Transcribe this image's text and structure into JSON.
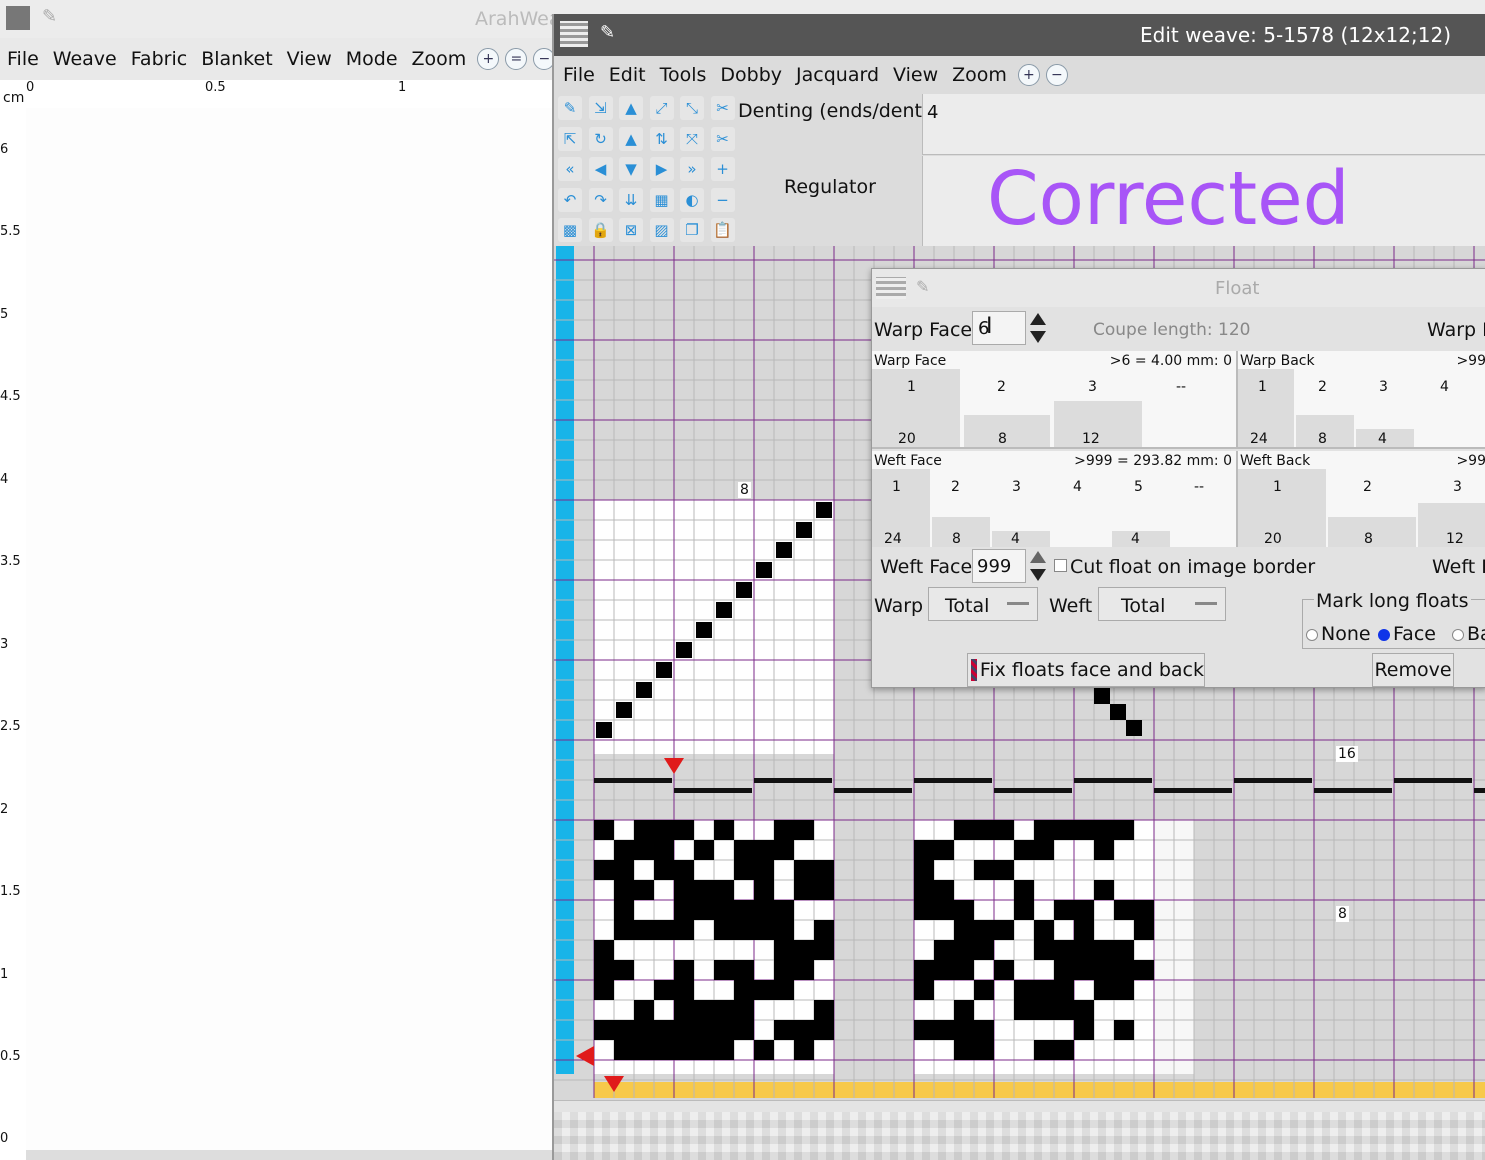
{
  "main_window": {
    "title": "ArahWeave",
    "menu": [
      "File",
      "Weave",
      "Fabric",
      "Blanket",
      "View",
      "Mode",
      "Zoom"
    ],
    "ruler": {
      "unit": "cm",
      "top_ticks": [
        "0",
        "0.5",
        "1"
      ],
      "left_ticks": [
        "6",
        "5.5",
        "5",
        "4.5",
        "4",
        "3.5",
        "3",
        "2.5",
        "2",
        "1.5",
        "1",
        "0.5",
        "0"
      ]
    }
  },
  "edit_window": {
    "title": "Edit weave: 5-1578 (12x12;12)",
    "menu": [
      "File",
      "Edit",
      "Tools",
      "Dobby",
      "Jacquard",
      "View",
      "Zoom"
    ],
    "denting_label": "Denting (ends/dent)",
    "denting_value": "4",
    "regulator_label": "Regulator",
    "corrected_text": "Corrected",
    "corrected_color": "#a855f7",
    "grid_labels": {
      "top": "8",
      "right_upper": "16",
      "right_lower": "8"
    },
    "tool_icons": [
      "broom-icon",
      "import-icon",
      "arrow-up-icon",
      "shift-diag-up-icon",
      "shift-diag-down-icon",
      "scissors-icon",
      "export-icon",
      "rotate-icon",
      "triangle-up-icon",
      "mirror-v-icon",
      "mirror-d-icon",
      "scissors-check-icon",
      "double-left-icon",
      "arrow-left-icon",
      "arrow-down-icon",
      "arrow-right-icon",
      "double-right-icon",
      "plus-icon",
      "undo-icon",
      "redo-icon",
      "double-down-icon",
      "checker-icon",
      "invert-icon",
      "minus-icon",
      "grid-icon",
      "lock-icon",
      "clear-icon",
      "pattern-icon",
      "copy-icon",
      "paste-icon"
    ]
  },
  "float_dialog": {
    "title": "Float",
    "warp_face_label": "Warp Face",
    "warp_face_value": "6",
    "coupe_length": "Coupe length: 120",
    "warp_back_label_trunc": "Warp B",
    "warp_face_panel": {
      "title": "Warp Face",
      "stat": ">6 = 4.00 mm: 0",
      "cols": [
        "1",
        "2",
        "3",
        "--"
      ],
      "counts": [
        "20",
        "8",
        "12",
        ""
      ]
    },
    "warp_back_panel": {
      "title": "Warp Back",
      "stat": ">99",
      "cols": [
        "1",
        "2",
        "3",
        "4"
      ],
      "counts": [
        "24",
        "8",
        "4",
        ""
      ]
    },
    "weft_face_panel": {
      "title": "Weft Face",
      "stat": ">999 = 293.82 mm: 0",
      "cols": [
        "1",
        "2",
        "3",
        "4",
        "5",
        "--"
      ],
      "counts": [
        "24",
        "8",
        "4",
        "",
        "4",
        ""
      ]
    },
    "weft_back_panel": {
      "title": "Weft Back",
      "stat": ">99",
      "cols": [
        "1",
        "2",
        "3"
      ],
      "counts": [
        "20",
        "8",
        "12"
      ]
    },
    "weft_face_label": "Weft Face",
    "weft_face_value": "999",
    "cut_float_label": "Cut float on image border",
    "weft_back_label_trunc": "Weft B",
    "warp_label": "Warp",
    "warp_select": "Total",
    "weft_label": "Weft",
    "weft_select": "Total",
    "mark_long_floats": {
      "title": "Mark long floats",
      "options": [
        "None",
        "Face",
        "Ba"
      ],
      "selected": "Face"
    },
    "fix_button": "Fix floats face and back",
    "remove_button": "Remove"
  }
}
